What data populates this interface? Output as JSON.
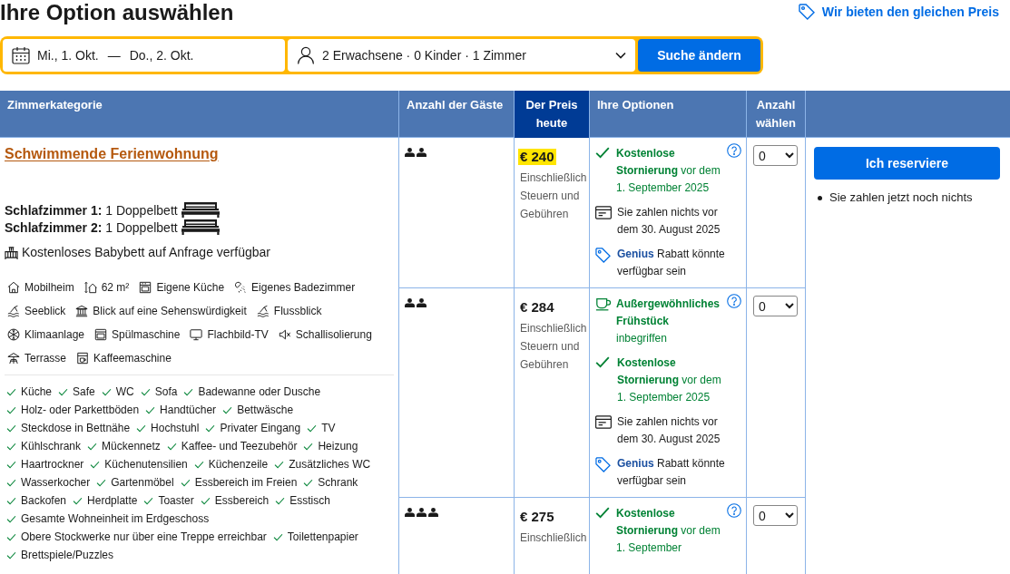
{
  "page": {
    "title": "Ihre Option auswählen",
    "price_match_link": "Wir bieten den gleichen Preis"
  },
  "search": {
    "check_in": "Mi., 1. Okt.",
    "date_separator": "—",
    "check_out": "Do., 2. Okt.",
    "guests": "2 Erwachsene · 0 Kinder · 1 Zimmer",
    "button": "Suche ändern"
  },
  "table": {
    "columns": [
      {
        "label": "Zimmerkategorie",
        "highlighted": false
      },
      {
        "label": "Anzahl der Gäste",
        "highlighted": false
      },
      {
        "label": "Der Preis heute",
        "highlighted": true
      },
      {
        "label": "Ihre Optionen",
        "highlighted": false
      },
      {
        "label": "Anzahl wählen",
        "highlighted": false
      }
    ],
    "room": {
      "name": "Schwimmende Ferienwohnung",
      "beds": [
        {
          "text": "**Schlafzimmer 1:** 1 Doppelbett"
        },
        {
          "text": "**Schlafzimmer 2:** 1 Doppelbett"
        }
      ],
      "crib_note": "Kostenloses Babybett auf Anfrage verfügbar",
      "facilities": [
        {
          "kind": "house",
          "label": "Mobilheim"
        },
        {
          "kind": "area",
          "label": "62 m²"
        },
        {
          "kind": "kitchen",
          "label": "Eigene Küche"
        },
        {
          "kind": "bath",
          "label": "Eigenes Badezimmer"
        },
        {
          "kind": "view",
          "label": "Seeblick"
        },
        {
          "kind": "landmark",
          "label": "Blick auf eine Sehenswürdigkeit"
        },
        {
          "kind": "view",
          "label": "Flussblick"
        },
        {
          "kind": "ac",
          "label": "Klimaanlage"
        },
        {
          "kind": "dishwasher",
          "label": "Spülmaschine"
        },
        {
          "kind": "tv",
          "label": "Flachbild-TV"
        },
        {
          "kind": "soundproof",
          "label": "Schallisolierung"
        },
        {
          "kind": "terrace",
          "label": "Terrasse"
        },
        {
          "kind": "coffeemaker",
          "label": "Kaffeemaschine"
        }
      ],
      "amenities": [
        "Küche",
        "Safe",
        "WC",
        "Sofa",
        "Badewanne oder Dusche",
        "Holz- oder Parkettböden",
        "Handtücher",
        "Bettwäsche",
        "Steckdose in Bettnähe",
        "Hochstuhl",
        "Privater Eingang",
        "TV",
        "Kühlschrank",
        "Mückennetz",
        "Kaffee- und Teezubehör",
        "Heizung",
        "Haartrockner",
        "Küchenutensilien",
        "Küchenzeile",
        "Zusätzliches WC",
        "Wasserkocher",
        "Gartenmöbel",
        "Essbereich im Freien",
        "Schrank",
        "Backofen",
        "Herdplatte",
        "Toaster",
        "Essbereich",
        "Esstisch",
        "Gesamte Wohneinheit im Erdgeschoss",
        "Obere Stockwerke nur über eine Treppe erreichbar",
        "Toilettenpapier",
        "Brettspiele/Puzzles"
      ]
    },
    "rates": [
      {
        "guests": [
          {
            "kind": "adult"
          },
          {
            "kind": "adult"
          }
        ],
        "price": "€ 240",
        "price_highlighted": true,
        "price_note": "Einschließlich Steuern und Gebühren",
        "options": [
          {
            "kind": "cancellation",
            "text": "**Kostenlose Stornierung** vor dem 1. September 2025"
          },
          {
            "kind": "payment",
            "text": "Sie zahlen nichts vor dem 30. August 2025"
          },
          {
            "kind": "genius",
            "text": "**Genius** Rabatt könnte verfügbar sein"
          }
        ],
        "quantity": "0"
      },
      {
        "guests": [
          {
            "kind": "adult"
          },
          {
            "kind": "adult"
          }
        ],
        "price": "€ 284",
        "price_highlighted": false,
        "price_note": "Einschließlich Steuern und Gebühren",
        "options": [
          {
            "kind": "breakfast",
            "text": "**Außergewöhnliches Frühstück** inbegriffen"
          },
          {
            "kind": "cancellation",
            "text": "**Kostenlose Stornierung** vor dem 1. September 2025"
          },
          {
            "kind": "payment",
            "text": "Sie zahlen nichts vor dem 30. August 2025"
          },
          {
            "kind": "genius",
            "text": "**Genius** Rabatt könnte verfügbar sein"
          }
        ],
        "quantity": "0"
      },
      {
        "guests": [
          {
            "kind": "adult"
          },
          {
            "kind": "adult"
          },
          {
            "kind": "adult"
          }
        ],
        "price": "€ 275",
        "price_highlighted": false,
        "price_note": "Einschließlich",
        "options": [
          {
            "kind": "cancellation",
            "text": "**Kostenlose Stornierung** vor dem 1. September"
          }
        ],
        "quantity": "0"
      }
    ],
    "reserve": {
      "button": "Ich reserviere",
      "note": "Sie zahlen jetzt noch nichts"
    }
  }
}
